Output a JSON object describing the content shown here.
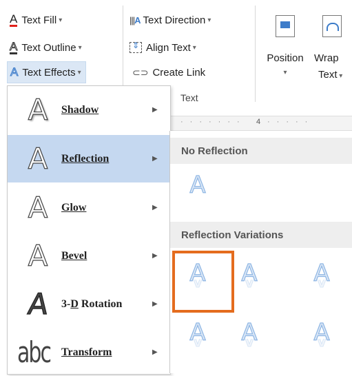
{
  "ribbon": {
    "text_fill": "Text Fill",
    "text_outline": "Text Outline",
    "text_effects": "Text Effects",
    "text_direction": "Text Direction",
    "align_text": "Align Text",
    "create_link": "Create Link",
    "group_text": "Text",
    "position": "Position",
    "wrap_l1": "Wrap",
    "wrap_l2": "Text",
    "ruler_mark": "4"
  },
  "menu": {
    "shadow": "Shadow",
    "reflection": "Reflection",
    "glow": "Glow",
    "bevel": "Bevel",
    "rotation_pre": "3-",
    "rotation_acc": "D",
    "rotation_post": " Rotation",
    "transform": "Transform",
    "abc_glyph": "abc"
  },
  "submenu": {
    "no_reflection": "No Reflection",
    "reflection_variations": "Reflection Variations"
  },
  "colors": {
    "accent_highlight": "#c5d8f0",
    "selection_border": "#e46c1e",
    "effect_blue": "#8eb6e4"
  }
}
